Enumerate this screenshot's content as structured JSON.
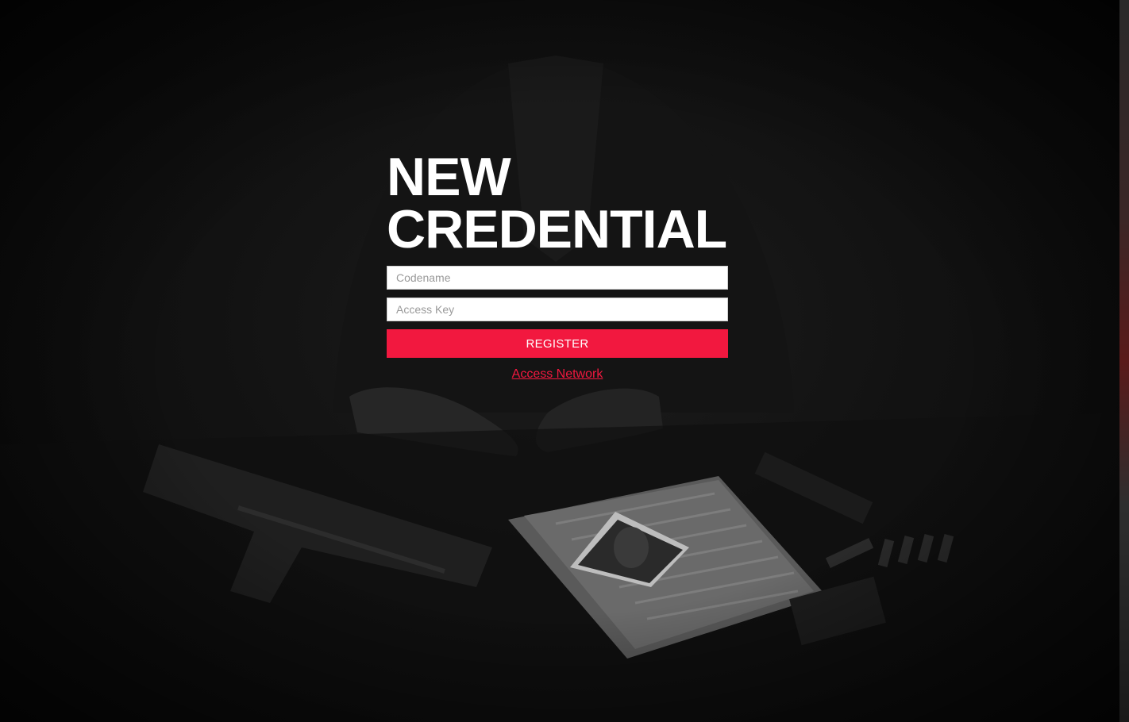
{
  "heading": {
    "line1": "NEW",
    "line2": "CREDENTIAL"
  },
  "form": {
    "codename_placeholder": "Codename",
    "codename_value": "",
    "access_key_placeholder": "Access Key",
    "access_key_value": "",
    "register_label": "REGISTER"
  },
  "footer_link": {
    "label": "Access Network"
  },
  "colors": {
    "accent": "#f2183f",
    "background": "#0b0b0b",
    "text": "#ffffff"
  }
}
